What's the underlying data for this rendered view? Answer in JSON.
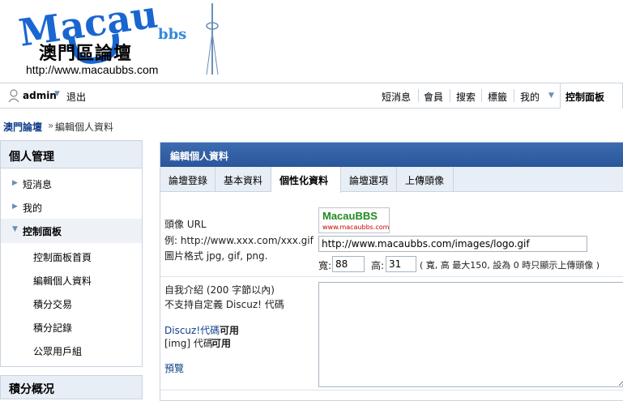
{
  "logo": {
    "url_text": "http://www.macaubbs.com",
    "wordmark": "Macau",
    "wordmark_suffix": "bbs",
    "chinese": "澳門區論壇"
  },
  "topbar": {
    "username": "admin",
    "logout": "退出",
    "nav": [
      "短消息",
      "會員",
      "搜索",
      "標籤",
      "我的"
    ],
    "control_panel": "控制面板"
  },
  "breadcrumb": {
    "home": "澳門論壇",
    "sep": "»",
    "current": "編輯個人資料"
  },
  "sidebar": {
    "title": "個人管理",
    "items": [
      "短消息",
      "我的"
    ],
    "control_panel": "控制面板",
    "subitems": [
      "控制面板首頁",
      "編輯個人資料",
      "積分交易",
      "積分記錄",
      "公眾用戶組"
    ],
    "next_title": "積分概况"
  },
  "main": {
    "title": "編輯個人資料",
    "tabs": [
      "論壇登錄",
      "基本資料",
      "個性化資料",
      "論壇選項",
      "上傳頭像"
    ],
    "active_tab": 2,
    "avatar": {
      "label": "頭像 URL",
      "example": "例: http://www.xxx.com/xxx.gif",
      "formats": "圖片格式 jpg, gif, png.",
      "preview_text": "MacauBBS",
      "preview_sub": "www.macaubbs.com",
      "url_value": "http://www.macaubbs.com/images/logo.gif",
      "width_label": "寬:",
      "width_value": "88",
      "height_label": "高:",
      "height_value": "31",
      "note": "( 寬, 高 最大150, 設為 0 時只顯示上傳頭像 )"
    },
    "bio": {
      "label": "自我介紹 (200 字節以內)",
      "note": "不支持自定義 Discuz! 代碼",
      "discuz_code": "Discuz!代碼",
      "discuz_status": "可用",
      "img_code": "[img] 代碼",
      "img_status": "可用",
      "preview": "預覽",
      "value": ""
    }
  },
  "colors": {
    "header_blue": "#2a559a",
    "link": "#12408a",
    "border": "#c8d4e0"
  }
}
